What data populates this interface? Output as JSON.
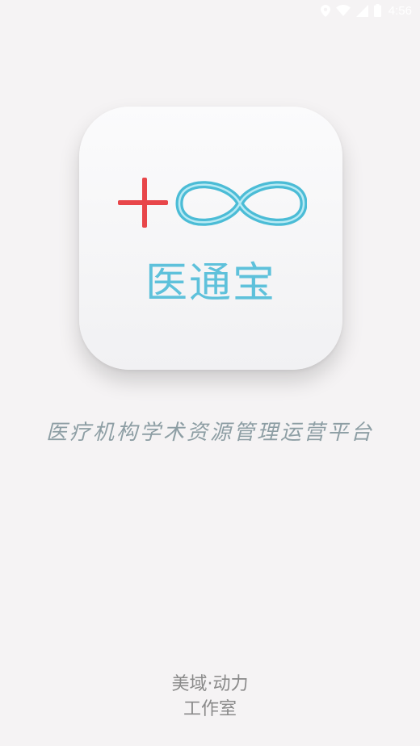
{
  "status_bar": {
    "time": "4:56",
    "icons": [
      "location-icon",
      "wifi-icon",
      "cellular-signal-icon",
      "battery-icon"
    ]
  },
  "app_icon": {
    "name": "医通宝",
    "logo_icons": [
      "plus-cross-icon",
      "infinity-icon"
    ],
    "colors": {
      "cross": "#e8464a",
      "infinity": "#4bbcd6",
      "name": "#5ec1db"
    }
  },
  "tagline": "医疗机构学术资源管理运营平台",
  "studio": {
    "line1": "美域·动力",
    "line2": "工作室"
  }
}
